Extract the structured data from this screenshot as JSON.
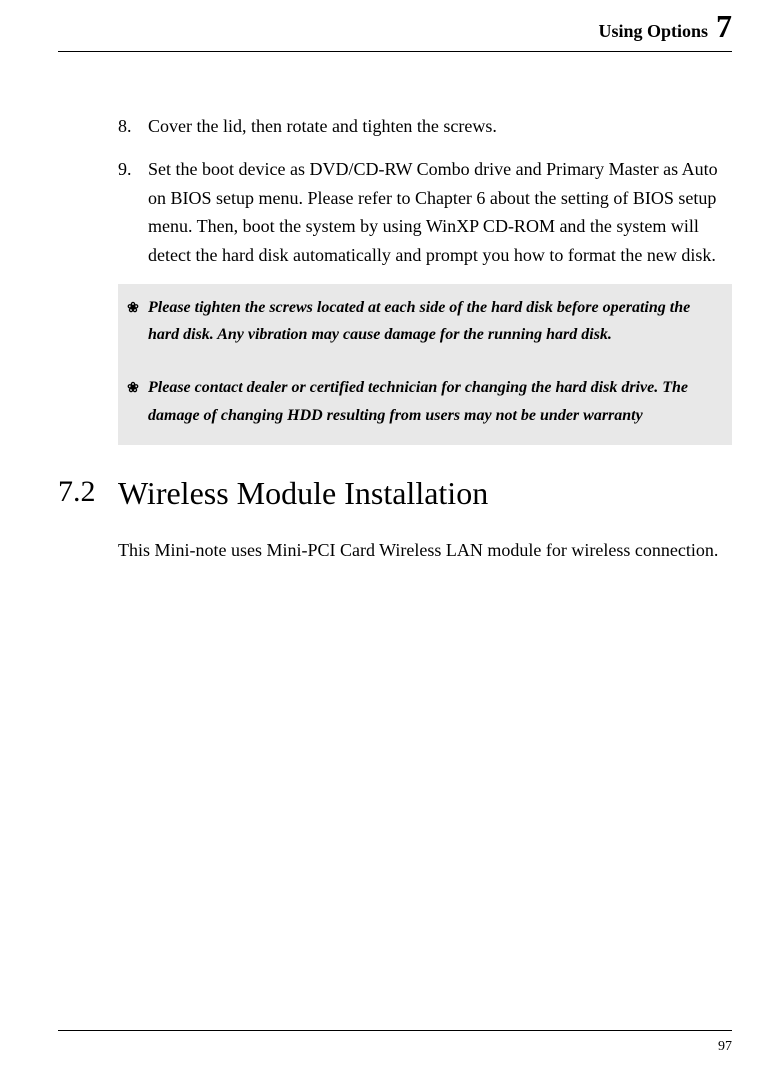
{
  "header": {
    "title": "Using Options",
    "chapter": "7"
  },
  "list": [
    {
      "num": "8.",
      "text": "Cover the lid, then rotate and tighten the screws."
    },
    {
      "num": "9.",
      "text": "Set the boot device as DVD/CD-RW Combo drive and Primary Master as Auto on BIOS setup menu. Please refer to Chapter 6 about the setting of BIOS setup menu. Then, boot the system by using WinXP CD-ROM and the system will detect the hard disk automatically and prompt you how to format the new disk."
    }
  ],
  "notes": [
    {
      "bullet": "❀",
      "text": "Please tighten the screws located at each side of the hard disk before operating the hard disk. Any vibration may cause damage for the running hard disk."
    },
    {
      "bullet": "❀",
      "text": "Please contact dealer or certified technician for changing the hard disk drive. The damage of changing HDD resulting from users may not be under warranty"
    }
  ],
  "section": {
    "num": "7.2",
    "title": "Wireless Module Installation",
    "body": "This Mini-note uses Mini-PCI Card Wireless LAN module for wireless connection."
  },
  "footer": {
    "page": "97"
  }
}
